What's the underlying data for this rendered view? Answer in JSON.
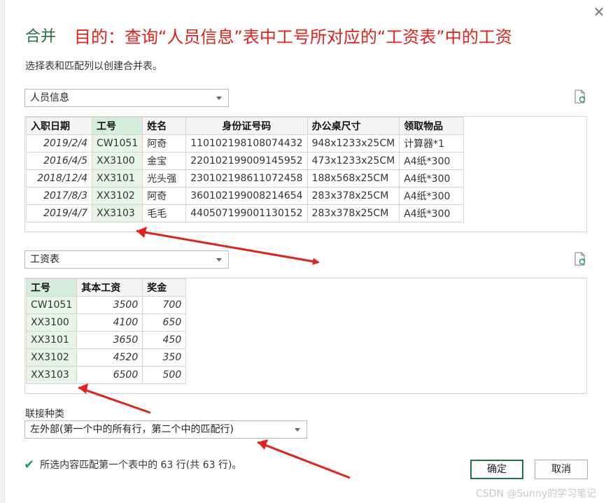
{
  "dialog": {
    "title": "合并",
    "annotation": "目的：查询“人员信息”表中工号所对应的“工资表”中的工资",
    "instruction": "选择表和匹配列以创建合并表。",
    "close_glyph": "✕"
  },
  "table1": {
    "selected": "人员信息",
    "headers": [
      "入职日期",
      "工号",
      "姓名",
      "身份证号码",
      "办公桌尺寸",
      "领取物品"
    ],
    "rows": [
      [
        "2019/2/4",
        "CW1051",
        "阿奇",
        "110102198108074432",
        "948x1233x25CM",
        "计算器*1"
      ],
      [
        "2016/4/5",
        "XX3100",
        "金宝",
        "220102199009145952",
        "473x1233x25CM",
        "A4纸*300"
      ],
      [
        "2018/12/4",
        "XX3101",
        "光头强",
        "230102198611072458",
        "188x568x25CM",
        "A4纸*300"
      ],
      [
        "2017/8/3",
        "XX3102",
        "阿奇",
        "360102199008214654",
        "283x378x25CM",
        "A4纸*300"
      ],
      [
        "2019/4/7",
        "XX3103",
        "毛毛",
        "440507199001130152",
        "283x378x25CM",
        "A4纸*300"
      ]
    ]
  },
  "table2": {
    "selected": "工资表",
    "headers": [
      "工号",
      "其本工资",
      "奖金"
    ],
    "rows": [
      [
        "CW1051",
        "3500",
        "700"
      ],
      [
        "XX3100",
        "4100",
        "650"
      ],
      [
        "XX3101",
        "3650",
        "450"
      ],
      [
        "XX3102",
        "4520",
        "350"
      ],
      [
        "XX3103",
        "6500",
        "500"
      ]
    ]
  },
  "join": {
    "label": "联接种类",
    "selected": "左外部(第一个中的所有行，第二个中的匹配行)"
  },
  "status": {
    "text": "所选内容匹配第一个表中的 63 行(共 63 行)。",
    "icon": "check-icon"
  },
  "buttons": {
    "ok": "确定",
    "cancel": "取消"
  },
  "watermark": "CSDN @Sunny的学习笔记",
  "colors": {
    "accent": "#217346",
    "annotation": "#e3201b",
    "key_column": "#e6f4ea"
  }
}
